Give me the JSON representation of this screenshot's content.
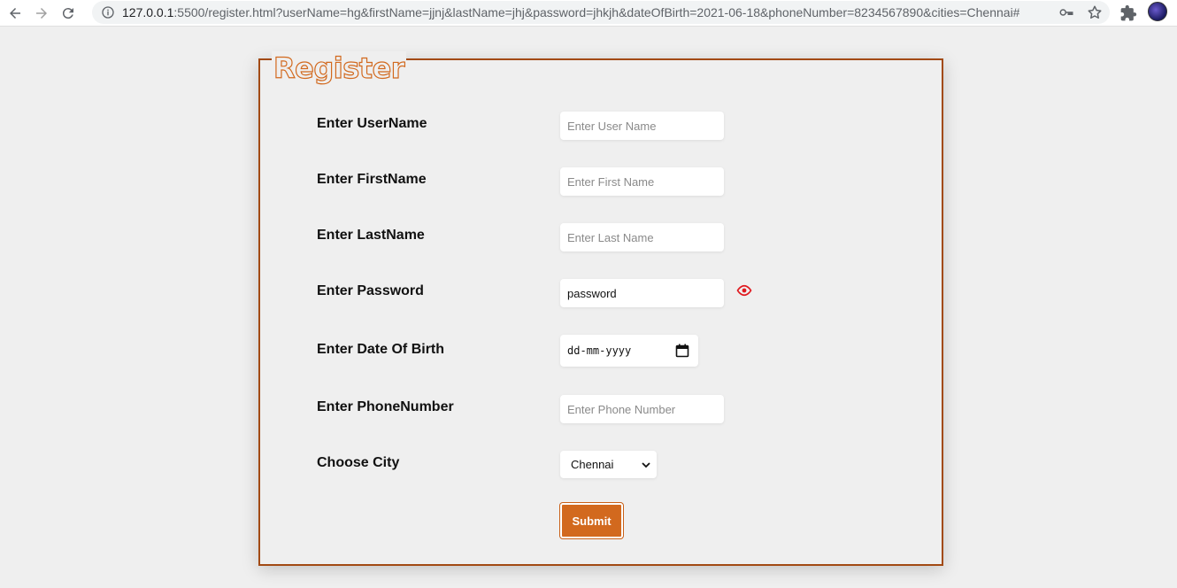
{
  "browser": {
    "url_host": "127.0.0.1",
    "url_rest": ":5500/register.html?userName=hg&firstName=jjnj&lastName=jhj&password=jhkjh&dateOfBirth=2021-06-18&phoneNumber=8234567890&cities=Chennai#"
  },
  "form": {
    "legend": "Register",
    "fields": {
      "username": {
        "label": "Enter UserName",
        "placeholder": "Enter User Name",
        "value": ""
      },
      "firstname": {
        "label": "Enter FirstName",
        "placeholder": "Enter First Name",
        "value": ""
      },
      "lastname": {
        "label": "Enter LastName",
        "placeholder": "Enter Last Name",
        "value": ""
      },
      "password": {
        "label": "Enter Password",
        "value": "password"
      },
      "dob": {
        "label": "Enter Date Of Birth",
        "placeholder": "dd-mm-yyyy"
      },
      "phone": {
        "label": "Enter PhoneNumber",
        "placeholder": "Enter Phone Number",
        "value": ""
      },
      "city": {
        "label": "Choose City",
        "selected": "Chennai"
      }
    },
    "submit_label": "Submit"
  },
  "colors": {
    "accent": "#d2691e",
    "border": "#a24a14",
    "eye_icon": "#e0191f"
  }
}
